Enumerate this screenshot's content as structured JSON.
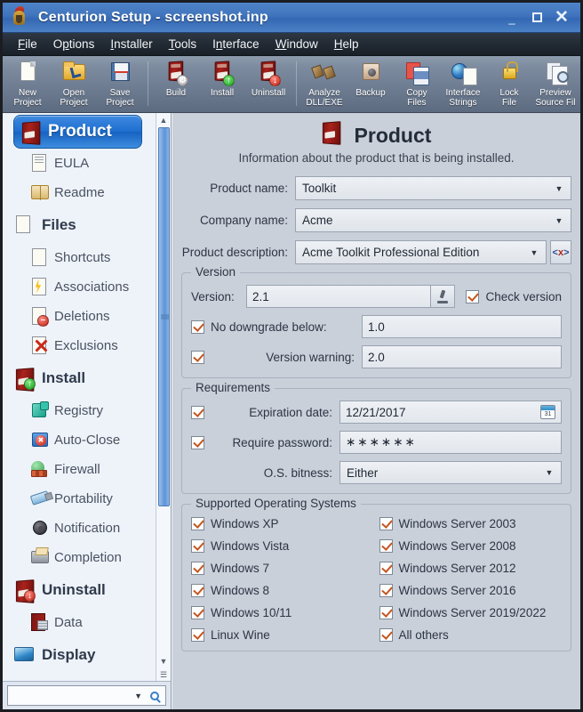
{
  "titlebar": {
    "title": "Centurion Setup - screenshot.inp",
    "app_icon": "centurion-helmet-icon",
    "minimize": "_",
    "maximize": "□",
    "close": "✕"
  },
  "menubar": {
    "items": [
      {
        "label": "File",
        "accel": "F"
      },
      {
        "label": "Options",
        "accel": "O"
      },
      {
        "label": "Installer",
        "accel": "I"
      },
      {
        "label": "Tools",
        "accel": "T"
      },
      {
        "label": "Interface",
        "accel": "I"
      },
      {
        "label": "Window",
        "accel": "W"
      },
      {
        "label": "Help",
        "accel": "H"
      }
    ]
  },
  "toolbar": {
    "buttons": [
      {
        "label": "New\nProject",
        "icon": "new-page-icon"
      },
      {
        "label": "Open\nProject",
        "icon": "open-folder-icon"
      },
      {
        "label": "Save\nProject",
        "icon": "floppy-disk-icon"
      },
      {
        "label": "Build",
        "icon": "product-box-gear-icon"
      },
      {
        "label": "Install",
        "icon": "product-box-down-green-icon"
      },
      {
        "label": "Uninstall",
        "icon": "product-box-red-icon"
      },
      {
        "label": "Analyze\nDLL/EXE",
        "icon": "analyze-blocks-icon"
      },
      {
        "label": "Backup",
        "icon": "safe-icon"
      },
      {
        "label": "Copy\nFiles",
        "icon": "copy-files-icon"
      },
      {
        "label": "Interface\nStrings",
        "icon": "globe-document-icon"
      },
      {
        "label": "Lock\nFile",
        "icon": "padlock-icon"
      },
      {
        "label": "Preview\nSource Fil",
        "icon": "preview-magnifier-icon"
      }
    ]
  },
  "sidebar": {
    "items": [
      {
        "label": "Product",
        "icon": "product-box-icon",
        "level": "head",
        "selected": true
      },
      {
        "label": "EULA",
        "icon": "eula-document-icon",
        "level": "child",
        "selected": false
      },
      {
        "label": "Readme",
        "icon": "readme-book-icon",
        "level": "child",
        "selected": false
      },
      {
        "label": "Files",
        "icon": "files-stack-icon",
        "level": "head",
        "selected": false
      },
      {
        "label": "Shortcuts",
        "icon": "shortcut-page-icon",
        "level": "child",
        "selected": false
      },
      {
        "label": "Associations",
        "icon": "associations-bolt-icon",
        "level": "child",
        "selected": false
      },
      {
        "label": "Deletions",
        "icon": "deletions-page-icon",
        "level": "child",
        "selected": false
      },
      {
        "label": "Exclusions",
        "icon": "exclusions-x-icon",
        "level": "child",
        "selected": false
      },
      {
        "label": "Install",
        "icon": "install-box-icon",
        "level": "head",
        "selected": false
      },
      {
        "label": "Registry",
        "icon": "registry-icon",
        "level": "child",
        "selected": false
      },
      {
        "label": "Auto-Close",
        "icon": "auto-close-icon",
        "level": "child",
        "selected": false
      },
      {
        "label": "Firewall",
        "icon": "firewall-icon",
        "level": "child",
        "selected": false
      },
      {
        "label": "Portability",
        "icon": "portability-usb-icon",
        "level": "child",
        "selected": false
      },
      {
        "label": "Notification",
        "icon": "notification-speaker-icon",
        "level": "child",
        "selected": false
      },
      {
        "label": "Completion",
        "icon": "completion-printer-icon",
        "level": "child",
        "selected": false
      },
      {
        "label": "Uninstall",
        "icon": "uninstall-box-icon",
        "level": "head",
        "selected": false
      },
      {
        "label": "Data",
        "icon": "data-box-icon",
        "level": "child",
        "selected": false
      },
      {
        "label": "Display",
        "icon": "display-monitor-icon",
        "level": "head",
        "selected": false
      }
    ],
    "search": {
      "value": "",
      "placeholder": "",
      "dropdown_icon": "chevron-down-icon",
      "search_icon": "magnifier-icon"
    },
    "scrollbar": {
      "up_icon": "chevron-up-icon",
      "down_icon": "chevron-down-icon",
      "thumb_percent": 72
    }
  },
  "main": {
    "page_icon": "product-box-icon",
    "title": "Product",
    "subtitle": "Information about the product that is being installed.",
    "fields": [
      {
        "label": "Product name:",
        "value": "Toolkit"
      },
      {
        "label": "Company name:",
        "value": "Acme"
      },
      {
        "label": "Product description:",
        "value": "Acme Toolkit Professional Edition"
      }
    ],
    "description_code_button": "<x>",
    "version_group": {
      "title": "Version",
      "version_label": "Version:",
      "version_value": "2.1",
      "inspect_icon": "microscope-icon",
      "check_version": {
        "label": "Check version",
        "checked": true
      },
      "no_downgrade": {
        "label": "No downgrade below:",
        "checked": true,
        "value": "1.0"
      },
      "version_warning": {
        "label": "Version warning:",
        "checked": true,
        "value": "2.0"
      }
    },
    "requirements_group": {
      "title": "Requirements",
      "expiration": {
        "label": "Expiration date:",
        "checked": true,
        "value": "12/21/2017",
        "icon": "calendar-icon",
        "icon_day": "31"
      },
      "password": {
        "label": "Require password:",
        "checked": true,
        "value": "∗∗∗∗∗∗"
      },
      "bitness": {
        "label": "O.S. bitness:",
        "value": "Either"
      }
    },
    "os_group": {
      "title": "Supported Operating Systems",
      "left_column": [
        {
          "label": "Windows XP",
          "checked": true
        },
        {
          "label": "Windows Vista",
          "checked": true
        },
        {
          "label": "Windows 7",
          "checked": true
        },
        {
          "label": "Windows 8",
          "checked": true
        },
        {
          "label": "Windows 10/11",
          "checked": true
        },
        {
          "label": "Linux Wine",
          "checked": true
        }
      ],
      "right_column": [
        {
          "label": "Windows Server 2003",
          "checked": true
        },
        {
          "label": "Windows Server 2008",
          "checked": true
        },
        {
          "label": "Windows Server 2012",
          "checked": true
        },
        {
          "label": "Windows Server 2016",
          "checked": true
        },
        {
          "label": "Windows Server 2019/2022",
          "checked": true
        },
        {
          "label": "All others",
          "checked": true
        }
      ]
    }
  },
  "colors": {
    "titlebar_blue": "#3f74bd",
    "selection_blue": "#1f6fd0",
    "panel_bg": "#c9d0da",
    "sidebar_bg": "#eef3fa",
    "check_orange": "#c4551e"
  }
}
